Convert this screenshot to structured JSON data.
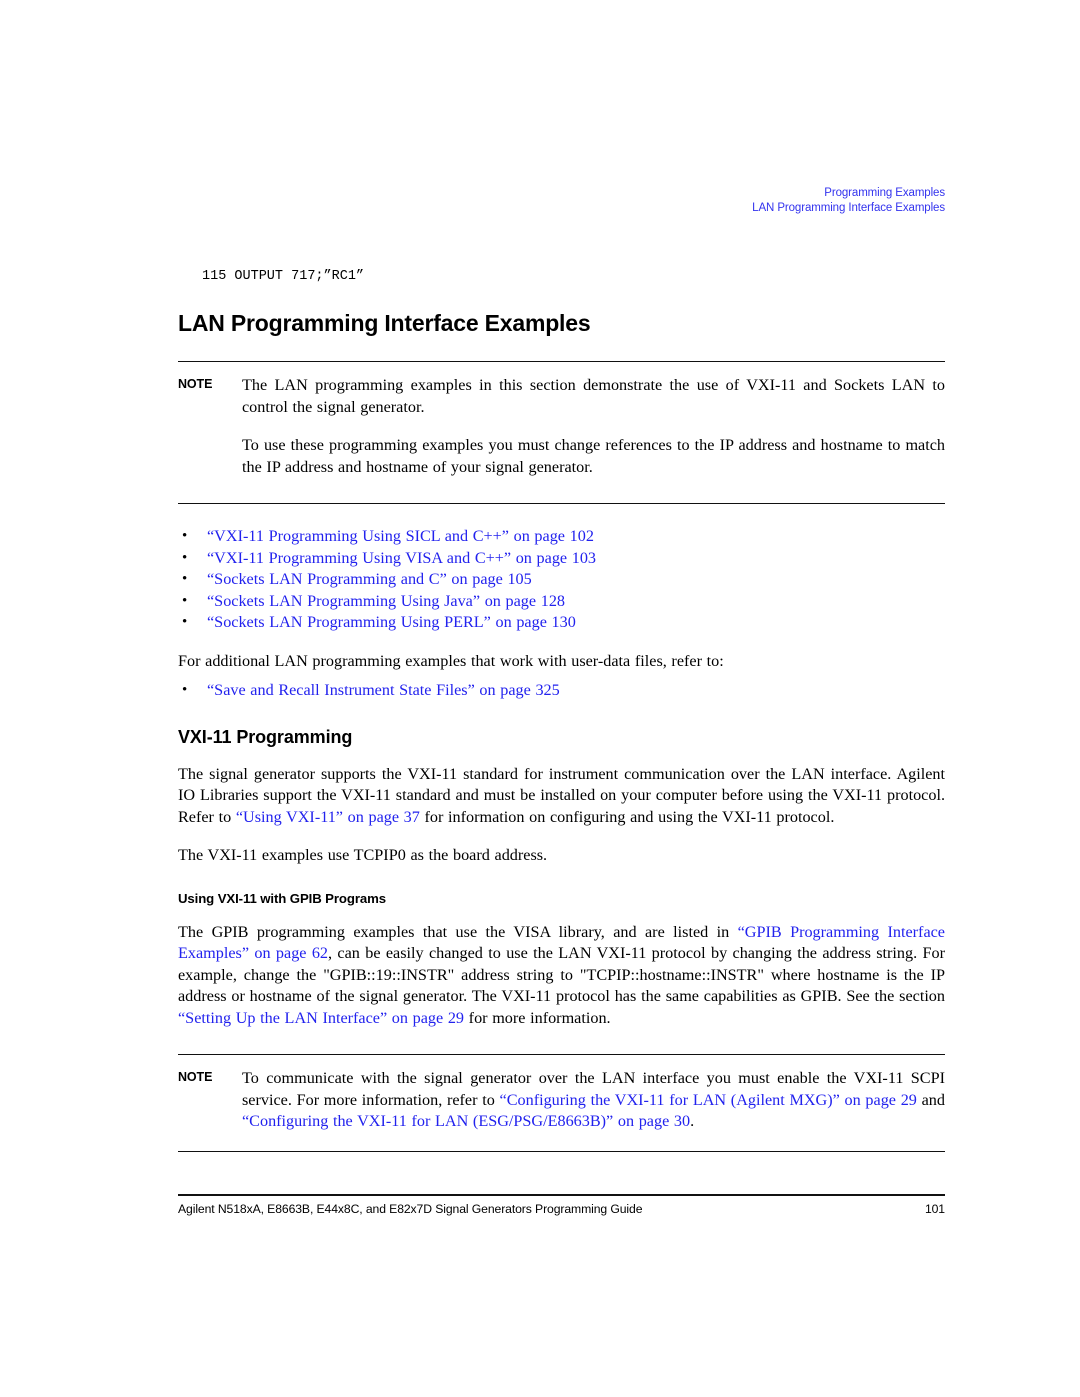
{
  "header": {
    "line1": "Programming Examples",
    "line2": "LAN Programming Interface Examples",
    "color": "#3333ee"
  },
  "code": {
    "line": "115 OUTPUT 717;”RC1”"
  },
  "title": "LAN Programming Interface Examples",
  "note1": {
    "label": "NOTE",
    "paragraph1": "The LAN programming examples in this section demonstrate the use of VXI-11 and Sockets LAN to control the signal generator.",
    "paragraph2": "To use these programming examples you must change references to the IP address and hostname to match the IP address and hostname of your signal generator."
  },
  "link_list": [
    "“VXI-11 Programming Using SICL and C++” on page 102",
    "“VXI-11 Programming Using VISA and C++” on page 103",
    "“Sockets LAN Programming and C” on page 105",
    "“Sockets LAN Programming Using Java” on page 128",
    "“Sockets LAN Programming Using PERL” on page 130"
  ],
  "userdata": {
    "intro": "For additional LAN programming examples that work with user-data files, refer to:",
    "link": "“Save and Recall Instrument State Files” on page 325"
  },
  "vxi_section": {
    "heading": "VXI-11 Programming",
    "para1_a": "The signal generator supports the VXI-11 standard for instrument communication over the LAN interface. Agilent IO Libraries support the VXI-11 standard and must be installed on your computer before using the VXI-11 protocol. Refer to ",
    "para1_link": "“Using VXI-11” on page 37",
    "para1_b": " for information on configuring and using the VXI-11 protocol.",
    "para2": "The VXI-11 examples use TCPIP0 as the board address."
  },
  "gpib_section": {
    "heading": "Using VXI-11 with GPIB Programs",
    "para_a": "The GPIB programming examples that use the VISA library, and are listed in ",
    "link1": "“GPIB Programming Interface Examples” on page 62",
    "para_b": ", can be easily changed to use the LAN VXI-11 protocol by changing the address string. For example, change the \"GPIB::19::INSTR\" address string to \"TCPIP::hostname::INSTR\" where hostname is the IP address or hostname of the signal generator. The VXI-11 protocol has the same capabilities as GPIB. See the section ",
    "link2": "“Setting Up the LAN Interface” on page 29",
    "para_c": " for more information."
  },
  "note2": {
    "label": "NOTE",
    "text_a": "To communicate with the signal generator over the LAN interface you must enable the VXI-11 SCPI service. For more information, refer to ",
    "link1": "“Configuring the VXI-11 for LAN (Agilent MXG)” on page 29",
    "text_b": " and ",
    "link2": "“Configuring the VXI-11 for LAN (ESG/PSG/E8663B)” on page 30",
    "text_c": "."
  },
  "footer": {
    "left": "Agilent N518xA, E8663B, E44x8C, and E82x7D Signal Generators Programming Guide",
    "page_number": "101"
  }
}
